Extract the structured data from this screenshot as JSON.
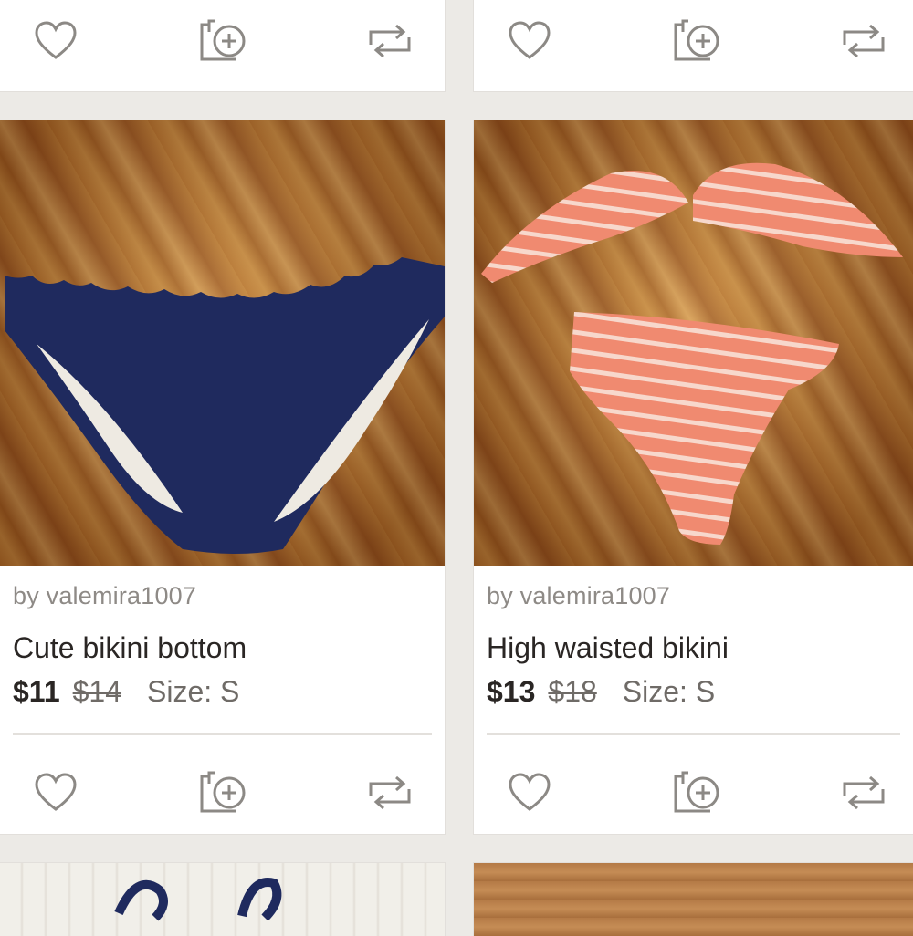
{
  "listings": [
    {
      "seller": "by valemira1007",
      "title": "Cute bikini bottom",
      "price": "$11",
      "original_price": "$14",
      "size": "Size: S"
    },
    {
      "seller": "by valemira1007",
      "title": "High waisted bikini",
      "price": "$13",
      "original_price": "$18",
      "size": "Size: S"
    }
  ],
  "icons": {
    "like": "heart-icon",
    "share": "share-to-party-icon",
    "repost": "repost-icon",
    "icon_color": "#8c8985"
  }
}
